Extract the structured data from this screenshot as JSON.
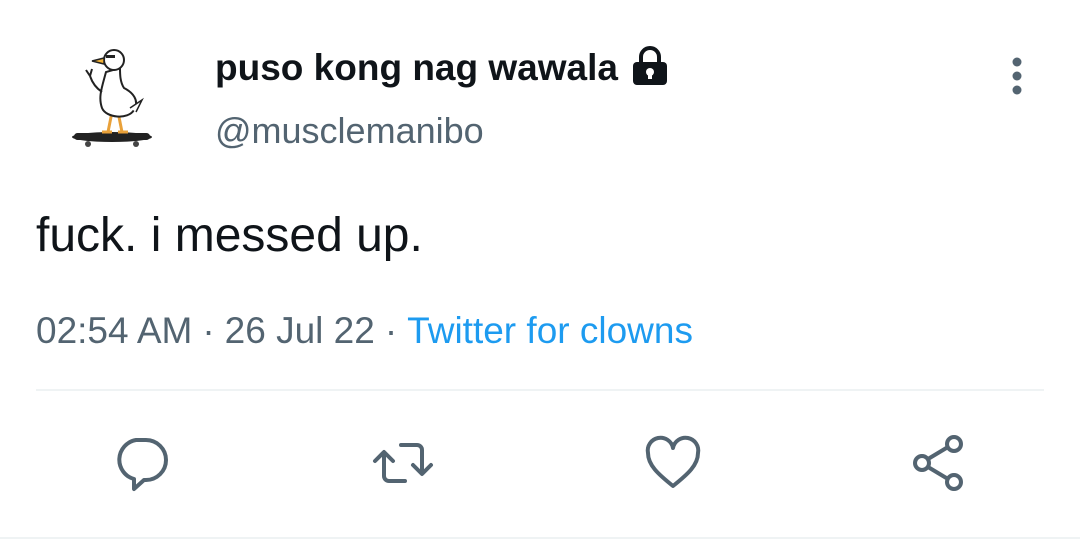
{
  "tweet": {
    "display_name": "puso kong nag wawala",
    "handle": "@musclemanibo",
    "text": "fuck. i messed up.",
    "time": "02:54 AM",
    "separator": "·",
    "date": "26 Jul 22",
    "source": "Twitter for clowns",
    "protected_icon": "lock-icon",
    "avatar": "white duck on a skateboard"
  },
  "actions": {
    "reply_icon": "reply-icon",
    "retweet_icon": "retweet-icon",
    "like_icon": "heart-icon",
    "share_icon": "share-icon"
  },
  "colors": {
    "text": "#0f1419",
    "secondary": "#536471",
    "link": "#1d9bf0",
    "divider": "#eff3f4"
  }
}
